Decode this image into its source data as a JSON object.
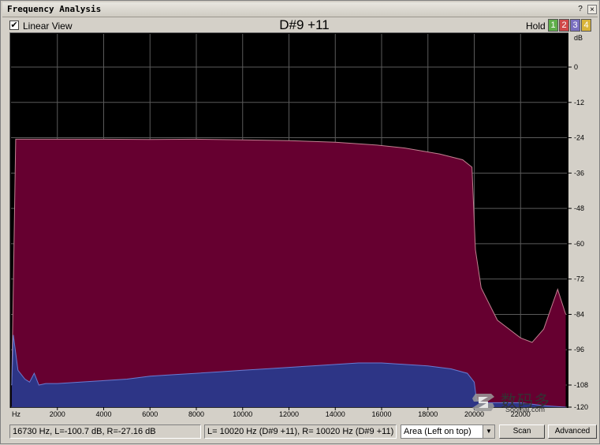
{
  "window": {
    "title": "Frequency Analysis",
    "help_label": "?",
    "close_label": "×"
  },
  "toolbar": {
    "linear_view_checked": true,
    "linear_view_check": "✔",
    "linear_view_label": "Linear View",
    "note": "D#9 +11",
    "hold_label": "Hold",
    "hold_buttons": [
      {
        "label": "1",
        "color": "#5fae4a"
      },
      {
        "label": "2",
        "color": "#d04848"
      },
      {
        "label": "3",
        "color": "#7a6fc0"
      },
      {
        "label": "4",
        "color": "#d9b43a"
      }
    ]
  },
  "chart_data": {
    "type": "area",
    "x_unit_label": "Hz",
    "y_unit_label": "dB",
    "xlim": [
      0,
      24000
    ],
    "ylim": [
      -120,
      12
    ],
    "x_ticks": [
      2000,
      4000,
      6000,
      8000,
      10000,
      12000,
      14000,
      16000,
      18000,
      20000,
      22000
    ],
    "x_tick_labels": [
      "2000",
      "4000",
      "6000",
      "8000",
      "10000",
      "12000",
      "14000",
      "16000",
      "18000",
      "20000",
      "22000"
    ],
    "y_ticks": [
      0,
      -12,
      -24,
      -36,
      -48,
      -60,
      -72,
      -84,
      -96,
      -108,
      -120
    ],
    "y_tick_labels": [
      "0",
      "-12",
      "-24",
      "-36",
      "-48",
      "-60",
      "-72",
      "-84",
      "-96",
      "-108",
      "-120"
    ],
    "grid": true,
    "background": "#000000",
    "series": [
      {
        "color": "#660030",
        "edge_color": "#c08090",
        "x": [
          30,
          200,
          2000,
          4000,
          6000,
          8000,
          10000,
          12000,
          14000,
          15800,
          17000,
          18500,
          19500,
          19900,
          20050,
          20300,
          21000,
          22000,
          22500,
          23000,
          23400,
          23600,
          23950
        ],
        "y": [
          -108,
          -24.5,
          -24.5,
          -24.5,
          -24.6,
          -24.5,
          -24.7,
          -25.0,
          -25.5,
          -26.5,
          -27.5,
          -29.5,
          -31.5,
          -34.0,
          -62.0,
          -75.0,
          -86.0,
          -92.0,
          -93.5,
          -89.0,
          -80.0,
          -75.5,
          -84.0
        ]
      },
      {
        "color": "#2d3586",
        "edge_color": "#6a7ad0",
        "x": [
          30,
          100,
          300,
          600,
          800,
          1000,
          1200,
          1500,
          2000,
          3000,
          4000,
          5000,
          6000,
          7000,
          8000,
          9000,
          10000,
          11000,
          12000,
          13000,
          14000,
          15000,
          16000,
          17000,
          18000,
          19000,
          19700,
          20000,
          20100,
          20500,
          21000,
          22000,
          23000,
          23950
        ],
        "y": [
          -108,
          -91,
          -103,
          -106,
          -107,
          -104,
          -108,
          -107.5,
          -107.5,
          -107,
          -106.5,
          -106,
          -105,
          -104.5,
          -104,
          -103.5,
          -103,
          -102.5,
          -102,
          -101.5,
          -101,
          -100.5,
          -100.5,
          -101,
          -101.5,
          -102.5,
          -104,
          -107,
          -113,
          -114,
          -114,
          -114,
          -115,
          -117
        ]
      }
    ]
  },
  "status": {
    "cursor_readout": "16730 Hz, L=-100.7 dB, R=-27.16 dB",
    "peak_readout": "L=  10020 Hz (D#9 +11), R=  10020 Hz (D#9 +11)"
  },
  "controls": {
    "display_mode": "Area (Left on top)",
    "dropdown_arrow": "▼",
    "scan_label": "Scan",
    "advanced_label": "Advanced"
  },
  "watermark": {
    "cn_text": "数码多",
    "url_text": "Soomal.com"
  }
}
